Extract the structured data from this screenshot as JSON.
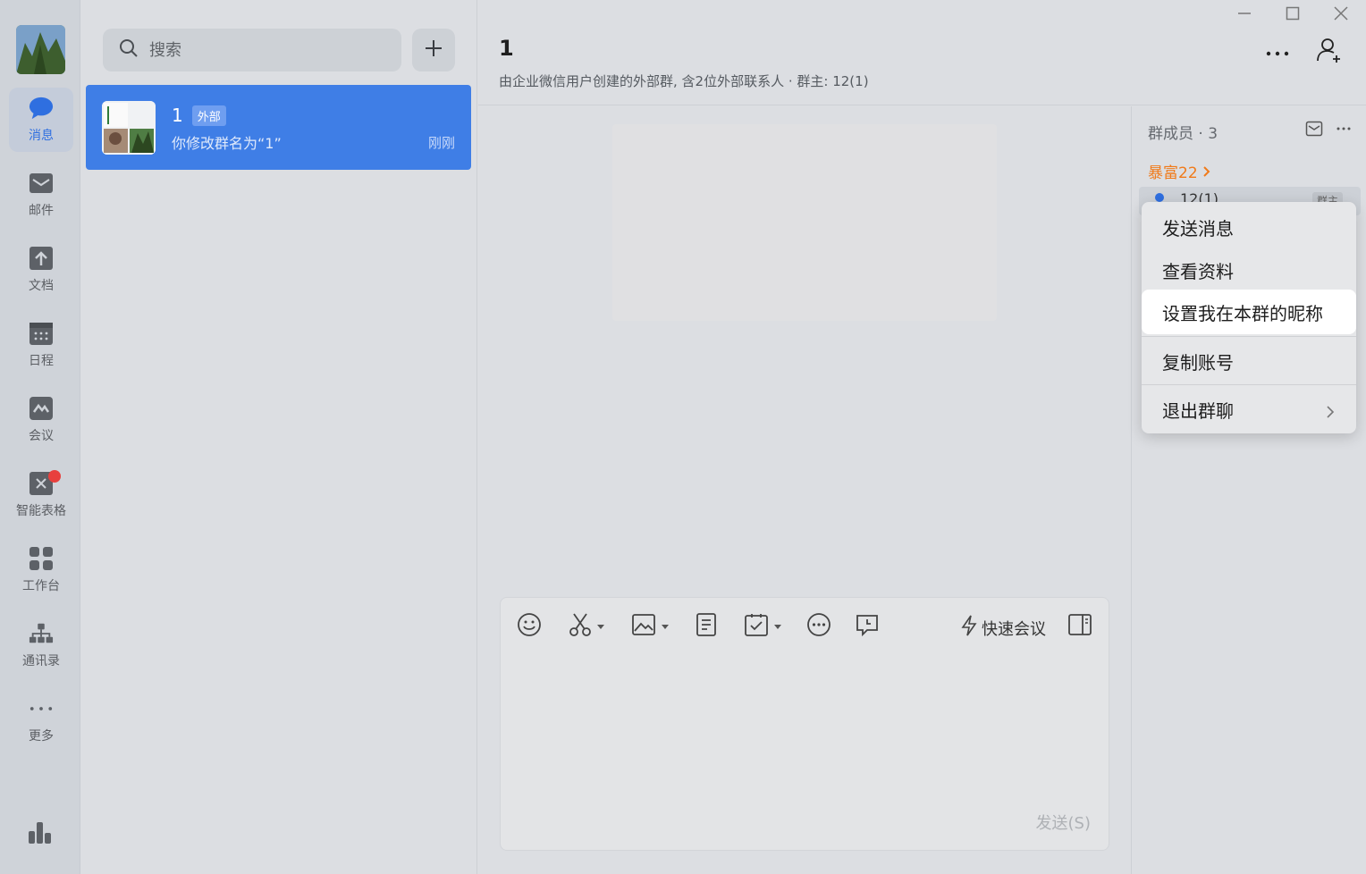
{
  "rail": {
    "items": [
      {
        "label": "消息",
        "icon": "chat-icon"
      },
      {
        "label": "邮件",
        "icon": "mail-icon"
      },
      {
        "label": "文档",
        "icon": "doc-icon"
      },
      {
        "label": "日程",
        "icon": "calendar-icon"
      },
      {
        "label": "会议",
        "icon": "meeting-icon"
      },
      {
        "label": "智能表格",
        "icon": "smart-table-icon"
      },
      {
        "label": "工作台",
        "icon": "workbench-icon"
      },
      {
        "label": "通讯录",
        "icon": "contacts-icon"
      },
      {
        "label": "更多",
        "icon": "more-icon"
      }
    ],
    "accent": "#2f6fe0"
  },
  "search": {
    "placeholder": "搜索"
  },
  "conversation": {
    "title": "1",
    "tag": "外部",
    "preview": "你修改群名为“1”",
    "time": "刚刚",
    "highlight": "#3f7ee6"
  },
  "chat": {
    "title": "1",
    "subtitle": "由企业微信用户创建的外部群, 含2位外部联系人 · 群主: 12(1)"
  },
  "composer": {
    "quick_meeting": "快速会议",
    "send": "发送(S)"
  },
  "members": {
    "title": "群成员 · 3",
    "owner_link": "暴富22",
    "row_name": "12(1)",
    "row_tag": "群主"
  },
  "context_menu": {
    "items": [
      "发送消息",
      "查看资料",
      "设置我在本群的昵称",
      "复制账号",
      "退出群聊"
    ]
  }
}
